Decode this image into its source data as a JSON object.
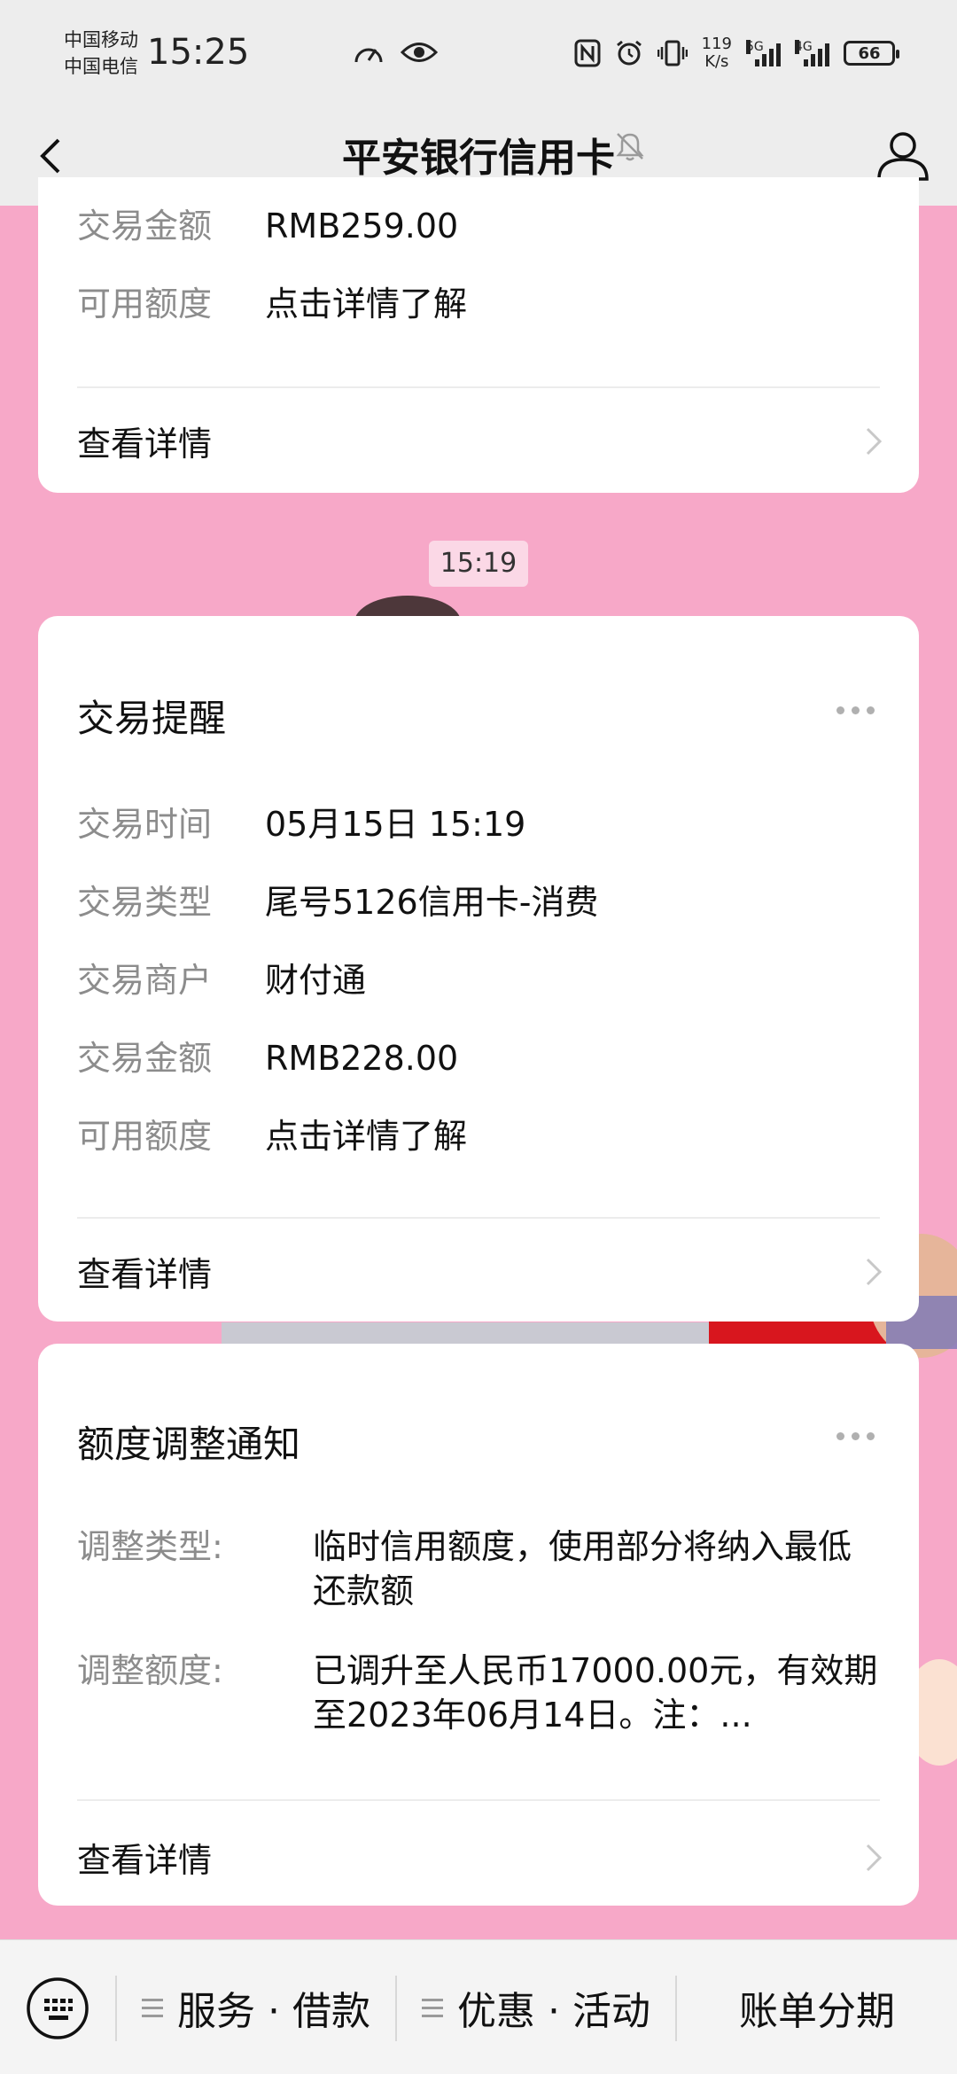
{
  "status_bar": {
    "carrier_1": "中国移动",
    "carrier_2": "中国电信",
    "time": "15:25",
    "net_speed_value": "119",
    "net_speed_unit": "K/s",
    "signal_1_tag": "5G",
    "signal_2_tag": "4G",
    "battery": "66"
  },
  "nav": {
    "title": "平安银行信用卡"
  },
  "card_top": {
    "rows": [
      {
        "label": "交易金额",
        "value": "RMB259.00"
      },
      {
        "label": "可用额度",
        "value": "点击详情了解"
      }
    ],
    "detail_label": "查看详情"
  },
  "timestamp": "15:19",
  "card_txn": {
    "title": "交易提醒",
    "rows": [
      {
        "label": "交易时间",
        "value": "05月15日 15:19"
      },
      {
        "label": "交易类型",
        "value": "尾号5126信用卡-消费"
      },
      {
        "label": "交易商户",
        "value": "财付通"
      },
      {
        "label": "交易金额",
        "value": "RMB228.00"
      },
      {
        "label": "可用额度",
        "value": "点击详情了解"
      }
    ],
    "detail_label": "查看详情"
  },
  "card_limit": {
    "title": "额度调整通知",
    "rows": [
      {
        "label": "调整类型:",
        "value": "临时信用额度，使用部分将纳入最低还款额"
      },
      {
        "label": "调整额度:",
        "value": "已调升至人民币17000.00元，有效期至2023年06月14日。注：..."
      }
    ],
    "detail_label": "查看详情"
  },
  "bottom_menu": {
    "items": [
      "服务 · 借款",
      "优惠 · 活动",
      "账单分期"
    ]
  },
  "colors": {
    "chat_background": "#f7a8c8",
    "bar_background": "#ededed"
  }
}
